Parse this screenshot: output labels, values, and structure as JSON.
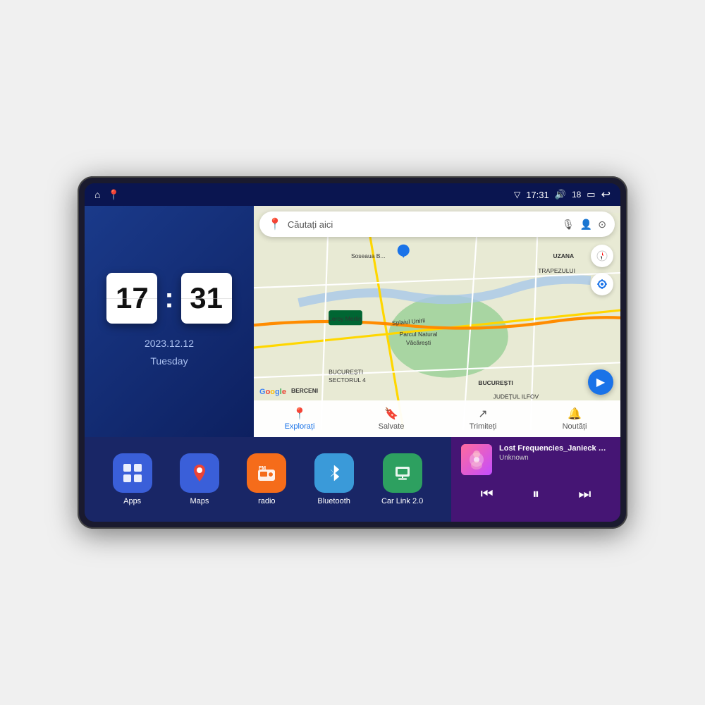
{
  "device": {
    "screen": {
      "statusBar": {
        "leftIcons": [
          "home-icon",
          "maps-status-icon"
        ],
        "time": "17:31",
        "signal": "▽",
        "volume": "🔊",
        "battery": "18",
        "batteryIcon": "🔋",
        "back": "↩"
      },
      "clock": {
        "hours": "17",
        "minutes": "31",
        "date": "2023.12.12",
        "day": "Tuesday"
      },
      "map": {
        "searchPlaceholder": "Căutați aici",
        "navItems": [
          {
            "label": "Explorați",
            "icon": "📍",
            "active": true
          },
          {
            "label": "Salvate",
            "icon": "🔖",
            "active": false
          },
          {
            "label": "Trimiteți",
            "icon": "⊕",
            "active": false
          },
          {
            "label": "Noutăți",
            "icon": "🔔",
            "active": false
          }
        ],
        "labels": {
          "berceni": "BERCENI",
          "bucuresti": "BUCUREȘTI",
          "judetulIlfov": "JUDEȚUL ILFOV",
          "trapezului": "TRAPEZULUI",
          "parcul": "Parcul Natural Văcărești",
          "leroyMerlin": "Leroy Merlin",
          "splaiul": "Splaiul Unirii",
          "bucuresti4": "BUCUREȘTI\nSECTORUL 4",
          "uzana": "UZANA",
          "sosea": "Soseaua B..."
        }
      },
      "apps": [
        {
          "id": "apps",
          "label": "Apps",
          "icon": "⊞",
          "color": "#3a5fd9"
        },
        {
          "id": "maps",
          "label": "Maps",
          "icon": "📍",
          "color": "#3a5fd9"
        },
        {
          "id": "radio",
          "label": "radio",
          "icon": "📻",
          "color": "#f56c1a"
        },
        {
          "id": "bluetooth",
          "label": "Bluetooth",
          "icon": "⬡",
          "color": "#3a9ad9"
        },
        {
          "id": "carlink",
          "label": "Car Link 2.0",
          "icon": "📱",
          "color": "#2da060"
        }
      ],
      "music": {
        "title": "Lost Frequencies_Janieck Devy-...",
        "artist": "Unknown",
        "prevIcon": "⏮",
        "playIcon": "⏸",
        "nextIcon": "⏭"
      }
    }
  }
}
